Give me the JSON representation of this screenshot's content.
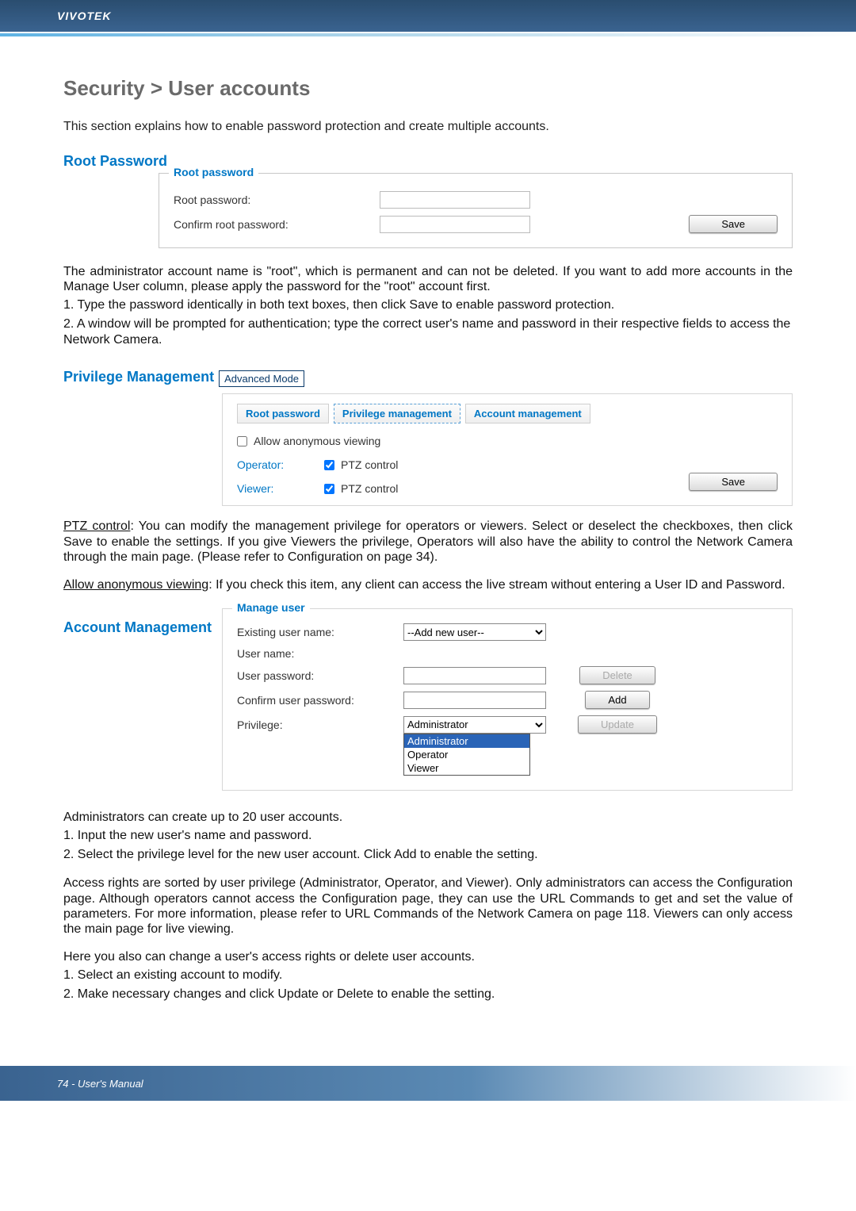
{
  "header": {
    "brand": "VIVOTEK"
  },
  "title": "Security > User accounts",
  "intro": "This section explains how to enable password protection and create multiple accounts.",
  "root_pw_section": {
    "heading": "Root Password",
    "legend": "Root password",
    "row1_label": "Root password:",
    "row2_label": "Confirm root password:",
    "save_btn": "Save"
  },
  "root_pw_para": "The administrator account name is \"root\", which is permanent and can not be deleted. If you want to add more accounts in the Manage User column, please apply the password for the \"root\" account first.",
  "root_pw_num1": "1. Type the password identically in both text boxes, then click Save to enable password protection.",
  "root_pw_num2": "2. A window will be prompted for authentication; type the correct user's name and password in their respective fields to access the Network Camera.",
  "priv_section": {
    "heading": "Privilege Management",
    "mode": "Advanced Mode",
    "tab1": "Root password",
    "tab2": "Privilege management",
    "tab3": "Account management",
    "anon_label": "Allow anonymous viewing",
    "operator_label": "Operator:",
    "viewer_label": "Viewer:",
    "ptz_label": "PTZ control",
    "save_btn": "Save"
  },
  "ptz_para_label": "PTZ control",
  "ptz_para_text": ": You can modify the management privilege for operators or viewers. Select or deselect the checkboxes, then click Save to enable the settings. If you give Viewers the privilege, Operators will also have the ability to control the Network Camera through the main page. (Please refer to Configuration on page 34).",
  "anon_para_label": "Allow anonymous viewing",
  "anon_para_text": ": If you check this item, any client can access the live stream without entering a User ID and Password.",
  "acct_section": {
    "heading": "Account Management",
    "legend": "Manage user",
    "existing_label": "Existing user name:",
    "existing_value": "--Add new user--",
    "username_label": "User name:",
    "userpass_label": "User password:",
    "confirmpass_label": "Confirm user password:",
    "privilege_label": "Privilege:",
    "privilege_value": "Administrator",
    "options": [
      "Administrator",
      "Operator",
      "Viewer"
    ],
    "delete_btn": "Delete",
    "add_btn": "Add",
    "update_btn": "Update"
  },
  "admin_para1": "Administrators can create up to 20 user accounts.",
  "admin_num1": "1. Input the new user's name and password.",
  "admin_num2": "2. Select the privilege level for the new user account. Click Add to enable the setting.",
  "access_para": "Access rights are sorted by user privilege (Administrator, Operator, and Viewer). Only administrators can access the Configuration page. Although operators cannot access the Configuration page, they can use the URL Commands to get and set the value of parameters. For more information, please refer to URL Commands of the Network Camera on page 118. Viewers can only access the main page for live viewing.",
  "change_para": "Here you also can change a user's access rights or delete user accounts.",
  "change_num1": "1. Select an existing account to modify.",
  "change_num2": "2. Make necessary changes and click Update or Delete to enable the setting.",
  "footer": {
    "page": "74 - User's Manual"
  }
}
